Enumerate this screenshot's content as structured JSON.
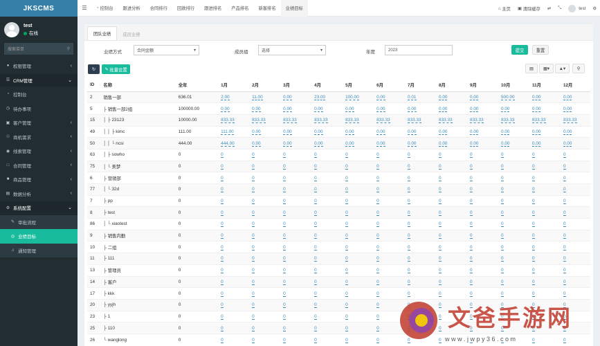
{
  "app": {
    "logo": "JKSCMS"
  },
  "user": {
    "name": "test",
    "status": "在线"
  },
  "sidebar": {
    "search_placeholder": "搜索菜单",
    "items": [
      {
        "label": "权限管理",
        "icon": "group-icon"
      },
      {
        "label": "CRM管理",
        "icon": "list-icon"
      },
      {
        "label": "控制台",
        "icon": "dashboard-icon"
      },
      {
        "label": "待办事项",
        "icon": "clock-icon"
      },
      {
        "label": "客户管理",
        "icon": "folder-icon"
      },
      {
        "label": "商机需求",
        "icon": "lightbulb-icon"
      },
      {
        "label": "线索管理",
        "icon": "eye-icon"
      },
      {
        "label": "合同管理",
        "icon": "file-icon"
      },
      {
        "label": "商品管理",
        "icon": "cube-icon"
      },
      {
        "label": "数据分析",
        "icon": "chart-icon"
      },
      {
        "label": "系统配置",
        "icon": "gears-icon"
      },
      {
        "label": "审批流程",
        "icon": "pencil-icon"
      },
      {
        "label": "业绩目标",
        "icon": "globe-icon"
      },
      {
        "label": "通知管理",
        "icon": "bell-icon"
      }
    ]
  },
  "topbar": {
    "tabs": [
      "控制台",
      "跟进分析",
      "合同排行",
      "回款排行",
      "跟进排名",
      "产品排名",
      "新客排名",
      "业绩目标"
    ],
    "home": "主页",
    "clear_cache": "清除缓存",
    "username": "test"
  },
  "content_tabs": [
    "团队业绩",
    "成员业绩"
  ],
  "filters": {
    "method_label": "业绩方式",
    "method_value": "合同金额",
    "member_label": "成员组",
    "member_value": "选择",
    "year_label": "年度",
    "year_value": "2023",
    "submit": "提交",
    "reset": "重置",
    "batch": "批量设置"
  },
  "table": {
    "headers": [
      "ID",
      "名称",
      "全年",
      "1月",
      "2月",
      "3月",
      "4月",
      "5月",
      "6月",
      "7月",
      "8月",
      "9月",
      "10月",
      "11月",
      "12月"
    ],
    "rows": [
      {
        "id": "2",
        "name": "销售一部",
        "year": "636.01",
        "m": [
          "2.00",
          "11.00",
          "0.00",
          "23.00",
          "100.00",
          "0.00",
          "0.01",
          "0.00",
          "0.00",
          "500.00",
          "0.00",
          "0.00"
        ]
      },
      {
        "id": "5",
        "name": "├ 销售一部2组",
        "year": "100000.00",
        "m": [
          "0.00",
          "0.00",
          "0.00",
          "0.00",
          "0.00",
          "0.00",
          "0.00",
          "0.00",
          "0.00",
          "0.00",
          "0.00",
          "0.00"
        ]
      },
      {
        "id": "15",
        "name": "│ ├ 23123",
        "year": "10000.00",
        "m": [
          "833.33",
          "833.33",
          "833.33",
          "833.33",
          "833.33",
          "833.33",
          "833.33",
          "833.33",
          "833.33",
          "833.33",
          "833.33",
          "833.33"
        ]
      },
      {
        "id": "49",
        "name": "│ │ ├ kimc",
        "year": "111.00",
        "m": [
          "111.00",
          "0.00",
          "0.00",
          "0.00",
          "0.00",
          "0.00",
          "0.00",
          "0.00",
          "0.00",
          "0.00",
          "0.00",
          "0.00"
        ]
      },
      {
        "id": "50",
        "name": "│ │ └ ncsi",
        "year": "444.00",
        "m": [
          "444.00",
          "0.00",
          "0.00",
          "0.00",
          "0.00",
          "0.00",
          "0.00",
          "0.00",
          "0.00",
          "0.00",
          "0.00",
          "0.00"
        ]
      },
      {
        "id": "63",
        "name": "│ ├ sowho",
        "year": "0",
        "m": [
          "0",
          "0",
          "0",
          "0",
          "0",
          "0",
          "0",
          "0",
          "0",
          "0",
          "0",
          "0"
        ]
      },
      {
        "id": "75",
        "name": "│ └ 美梦",
        "year": "0",
        "m": [
          "0",
          "0",
          "0",
          "0",
          "0",
          "0",
          "0",
          "0",
          "0",
          "0",
          "0",
          "0"
        ]
      },
      {
        "id": "6",
        "name": "├ 营销部",
        "year": "0",
        "m": [
          "0",
          "0",
          "0",
          "0",
          "0",
          "0",
          "0",
          "0",
          "0",
          "0",
          "0",
          "0"
        ]
      },
      {
        "id": "77",
        "name": "│ └ 32d",
        "year": "0",
        "m": [
          "0",
          "0",
          "0",
          "0",
          "0",
          "0",
          "0",
          "0",
          "0",
          "0",
          "0",
          "0"
        ]
      },
      {
        "id": "7",
        "name": "├ pp",
        "year": "0",
        "m": [
          "0",
          "0",
          "0",
          "0",
          "0",
          "0",
          "0",
          "0",
          "0",
          "0",
          "0",
          "0"
        ]
      },
      {
        "id": "8",
        "name": "├ test",
        "year": "0",
        "m": [
          "0",
          "0",
          "0",
          "0",
          "0",
          "0",
          "0",
          "0",
          "0",
          "0",
          "0",
          "0"
        ]
      },
      {
        "id": "86",
        "name": "│ └ xiaotest",
        "year": "0",
        "m": [
          "0",
          "0",
          "0",
          "0",
          "0",
          "0",
          "0",
          "0",
          "0",
          "0",
          "0",
          "0"
        ]
      },
      {
        "id": "9",
        "name": "├ 销售内勤",
        "year": "0",
        "m": [
          "0",
          "0",
          "0",
          "0",
          "0",
          "0",
          "0",
          "0",
          "0",
          "0",
          "0",
          "0"
        ]
      },
      {
        "id": "10",
        "name": "├ 二组",
        "year": "0",
        "m": [
          "0",
          "0",
          "0",
          "0",
          "0",
          "0",
          "0",
          "0",
          "0",
          "0",
          "0",
          "0"
        ]
      },
      {
        "id": "11",
        "name": "├ 111",
        "year": "0",
        "m": [
          "0",
          "0",
          "0",
          "0",
          "0",
          "0",
          "0",
          "0",
          "0",
          "0",
          "0",
          "0"
        ]
      },
      {
        "id": "13",
        "name": "├ 管理员",
        "year": "0",
        "m": [
          "0",
          "0",
          "0",
          "0",
          "0",
          "0",
          "0",
          "0",
          "0",
          "0",
          "0",
          "0"
        ]
      },
      {
        "id": "14",
        "name": "├ 客户",
        "year": "0",
        "m": [
          "0",
          "0",
          "0",
          "0",
          "0",
          "0",
          "0",
          "0",
          "0",
          "0",
          "0",
          "0"
        ]
      },
      {
        "id": "17",
        "name": "├ kkk",
        "year": "0",
        "m": [
          "0",
          "0",
          "0",
          "0",
          "0",
          "0",
          "0",
          "0",
          "0",
          "0",
          "0",
          "0"
        ]
      },
      {
        "id": "20",
        "name": "├ yyjh",
        "year": "0",
        "m": [
          "0",
          "0",
          "0",
          "0",
          "0",
          "0",
          "0",
          "0",
          "0",
          "0",
          "0",
          "0"
        ]
      },
      {
        "id": "23",
        "name": "├ 1",
        "year": "0",
        "m": [
          "0",
          "0",
          "0",
          "0",
          "0",
          "0",
          "0",
          "0",
          "0",
          "0",
          "0",
          "0"
        ]
      },
      {
        "id": "25",
        "name": "├ 110",
        "year": "0",
        "m": [
          "0",
          "0",
          "0",
          "0",
          "0",
          "0",
          "0",
          "0",
          "0",
          "0",
          "0",
          "0"
        ]
      },
      {
        "id": "26",
        "name": "└ wanglong",
        "year": "0",
        "m": [
          "0",
          "0",
          "0",
          "0",
          "0",
          "0",
          "0",
          "0",
          "0",
          "0",
          "0",
          "0"
        ]
      }
    ]
  },
  "watermark": {
    "text": "文爸手游网",
    "url": "w w w . j w p y 3 6 . c o m"
  }
}
